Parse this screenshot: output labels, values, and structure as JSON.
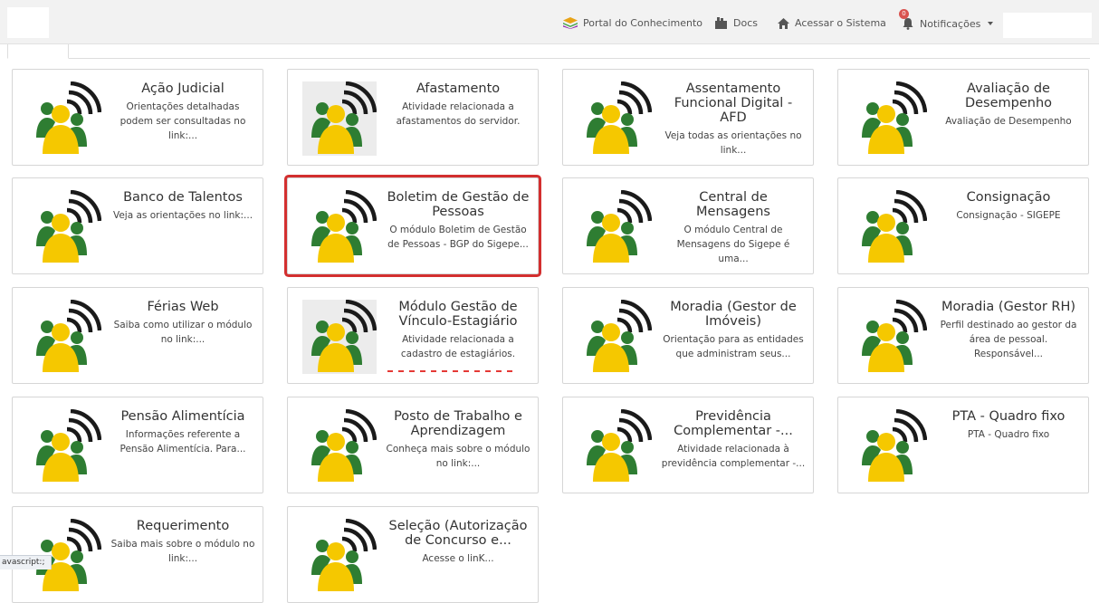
{
  "navbar": {
    "portal_label": "Portal do Conhecimento",
    "docs_label": "Docs",
    "acessar_label": "Acessar o Sistema",
    "notificacoes_label": "Notificações",
    "notification_count": "0",
    "icons": [
      "layers-icon",
      "docs-icon",
      "home-icon",
      "bell-icon",
      "caret-down-icon"
    ]
  },
  "cards": [
    {
      "title": "Ação Judicial",
      "desc": "Orientações detalhadas podem ser consultadas no link:..."
    },
    {
      "title": "Afastamento",
      "desc": "Atividade relacionada a afastamentos do servidor."
    },
    {
      "title": "Assentamento Funcional Digital - AFD",
      "desc": "Veja todas as orientações no link..."
    },
    {
      "title": "Avaliação de Desempenho",
      "desc": "Avaliação de Desempenho"
    },
    {
      "title": "Banco de Talentos",
      "desc": "Veja as orientações no link:..."
    },
    {
      "title": "Boletim de Gestão de Pessoas",
      "desc": "O módulo Boletim de Gestão de Pessoas - BGP do Sigepe..."
    },
    {
      "title": "Central de Mensagens",
      "desc": "O módulo Central de Mensagens do Sigepe é uma..."
    },
    {
      "title": "Consignação",
      "desc": "Consignação - SIGEPE"
    },
    {
      "title": "Férias Web",
      "desc": "Saiba como utilizar o módulo no link:..."
    },
    {
      "title": "Módulo Gestão de Vínculo-Estagiário",
      "desc": "Atividade relacionada a cadastro de estagiários."
    },
    {
      "title": "Moradia (Gestor de Imóveis)",
      "desc": "Orientação para as entidades que administram seus..."
    },
    {
      "title": "Moradia (Gestor RH)",
      "desc": "Perfil destinado ao gestor da área de pessoal. Responsável..."
    },
    {
      "title": "Pensão Alimentícia",
      "desc": "Informações referente a Pensão Alimentícia. Para..."
    },
    {
      "title": "Posto de Trabalho e Aprendizagem",
      "desc": "Conheça mais sobre o módulo no link:..."
    },
    {
      "title": "Previdência Complementar -...",
      "desc": "Atividade relacionada à previdência complementar -..."
    },
    {
      "title": "PTA - Quadro fixo",
      "desc": "PTA - Quadro fixo"
    },
    {
      "title": "Requerimento",
      "desc": "Saiba mais sobre o módulo no link:..."
    },
    {
      "title": "Seleção (Autorização de Concurso e...",
      "desc": "Acesse o linK..."
    }
  ],
  "status_bar": "avascript:;",
  "colors": {
    "wave": "#1a1a1a",
    "person_yellow": "#f5c800",
    "person_green": "#2e7d32",
    "highlight_border": "#d32f2f"
  }
}
